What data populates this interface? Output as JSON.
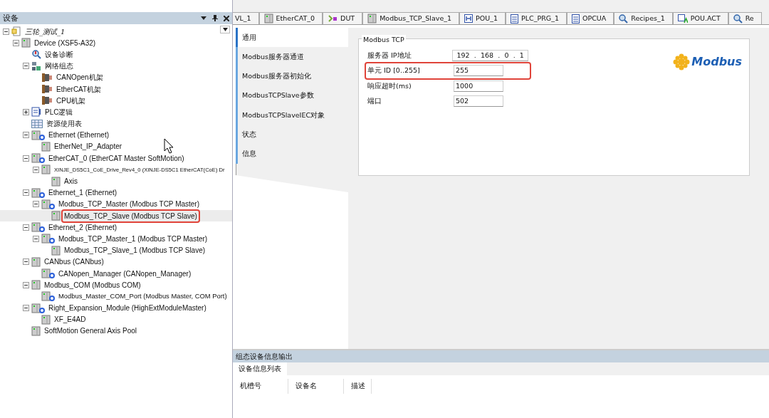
{
  "devices_panel": {
    "title": "设备",
    "tree": [
      {
        "label": "三轮_测试_1",
        "kind": "project",
        "expanded": true,
        "selected": false,
        "children": [
          {
            "label": "Device (XSF5-A32)",
            "kind": "device",
            "expanded": true,
            "selected": false,
            "children": [
              {
                "label": "设备诊断",
                "kind": "diag",
                "selected": false
              },
              {
                "label": "网络组态",
                "kind": "network",
                "expanded": true,
                "selected": false,
                "children": [
                  {
                    "label": "CANOpen机架",
                    "kind": "rack",
                    "selected": false
                  },
                  {
                    "label": "EtherCAT机架",
                    "kind": "rack",
                    "selected": false
                  },
                  {
                    "label": "CPU机架",
                    "kind": "rack",
                    "selected": false
                  }
                ]
              },
              {
                "label": "PLC逻辑",
                "kind": "plc",
                "expanded": false,
                "selected": false
              },
              {
                "label": "资源使用表",
                "kind": "table",
                "selected": false
              },
              {
                "label": "Ethernet (Ethernet)",
                "kind": "bus",
                "expanded": true,
                "selected": false,
                "children": [
                  {
                    "label": "EtherNet_IP_Adapter",
                    "kind": "device",
                    "selected": false
                  }
                ]
              },
              {
                "label": "EtherCAT_0 (EtherCAT Master SoftMotion)",
                "kind": "bus",
                "expanded": true,
                "selected": false,
                "children": [
                  {
                    "label": "XINJE_DS5C1_CoE_Drive_Rev4_0 (XINJE-DS5C1 EtherCAT(CoE) Dr",
                    "kind": "device",
                    "expanded": true,
                    "selected": false,
                    "children": [
                      {
                        "label": "Axis",
                        "kind": "device",
                        "selected": false
                      }
                    ]
                  }
                ]
              },
              {
                "label": "Ethernet_1 (Ethernet)",
                "kind": "bus",
                "expanded": true,
                "selected": false,
                "children": [
                  {
                    "label": "Modbus_TCP_Master (Modbus TCP Master)",
                    "kind": "bus",
                    "expanded": true,
                    "selected": false,
                    "children": [
                      {
                        "label": "Modbus_TCP_Slave (Modbus TCP Slave)",
                        "kind": "device",
                        "selected": true,
                        "highlighted": true
                      }
                    ]
                  }
                ]
              },
              {
                "label": "Ethernet_2 (Ethernet)",
                "kind": "bus",
                "expanded": true,
                "selected": false,
                "children": [
                  {
                    "label": "Modbus_TCP_Master_1 (Modbus TCP Master)",
                    "kind": "bus",
                    "expanded": true,
                    "selected": false,
                    "children": [
                      {
                        "label": "Modbus_TCP_Slave_1 (Modbus TCP Slave)",
                        "kind": "device",
                        "selected": false
                      }
                    ]
                  }
                ]
              },
              {
                "label": "CANbus (CANbus)",
                "kind": "device",
                "expanded": true,
                "selected": false,
                "children": [
                  {
                    "label": "CANopen_Manager (CANopen_Manager)",
                    "kind": "bus",
                    "selected": false
                  }
                ]
              },
              {
                "label": "Modbus_COM (Modbus COM)",
                "kind": "device",
                "expanded": true,
                "selected": false,
                "children": [
                  {
                    "label": "Modbus_Master_COM_Port (Modbus Master, COM Port)",
                    "kind": "bus",
                    "selected": false
                  }
                ]
              },
              {
                "label": "Right_Expansion_Module (HighExtModuleMaster)",
                "kind": "bus",
                "expanded": true,
                "selected": false,
                "children": [
                  {
                    "label": "XF_E4AD",
                    "kind": "device",
                    "selected": false
                  }
                ]
              },
              {
                "label": "SoftMotion General Axis Pool",
                "kind": "device",
                "selected": false
              }
            ]
          }
        ]
      }
    ]
  },
  "editor_tabs": [
    {
      "label": "VL_1",
      "kind": "none",
      "selected": false
    },
    {
      "label": "EtherCAT_0",
      "kind": "device",
      "selected": false
    },
    {
      "label": "DUT",
      "kind": "dut",
      "selected": false
    },
    {
      "label": "Modbus_TCP_Slave_1",
      "kind": "device",
      "selected": false
    },
    {
      "label": "POU_1",
      "kind": "pou",
      "selected": false
    },
    {
      "label": "PLC_PRG_1",
      "kind": "doc",
      "selected": false
    },
    {
      "label": "OPCUA",
      "kind": "doc",
      "selected": false
    },
    {
      "label": "Recipes_1",
      "kind": "search",
      "selected": false
    },
    {
      "label": "POU.ACT",
      "kind": "action",
      "selected": false
    },
    {
      "label": "Re",
      "kind": "search",
      "selected": false
    }
  ],
  "side_tabs": [
    {
      "label": "通用",
      "selected": true
    },
    {
      "label": "Modbus服务器通道",
      "selected": false
    },
    {
      "label": "Modbus服务器初始化",
      "selected": false
    },
    {
      "label": "ModbusTCPSlave参数",
      "selected": false
    },
    {
      "label": "ModbusTCPSlaveIEC对象",
      "selected": false
    },
    {
      "label": "状态",
      "selected": false
    },
    {
      "label": "信息",
      "selected": false
    }
  ],
  "settings": {
    "group_title": "Modbus TCP",
    "logo_text": "Modbus",
    "fields": [
      {
        "label": "服务器 IP地址",
        "kind": "ip",
        "parts": [
          "192",
          "168",
          "0",
          "1"
        ],
        "separator": ".",
        "highlighted": false
      },
      {
        "label": "单元 ID [0..255]",
        "kind": "text",
        "value": "255",
        "highlighted": true
      },
      {
        "label": "响应超时(ms)",
        "kind": "text",
        "value": "1000",
        "highlighted": false
      },
      {
        "label": "端口",
        "kind": "text",
        "value": "502",
        "highlighted": false
      }
    ]
  },
  "output_panel": {
    "title": "组态设备信息输出",
    "tabs": [
      {
        "label": "设备信息列表",
        "selected": true
      }
    ],
    "columns": [
      "机槽号",
      "设备名",
      "描述"
    ]
  }
}
